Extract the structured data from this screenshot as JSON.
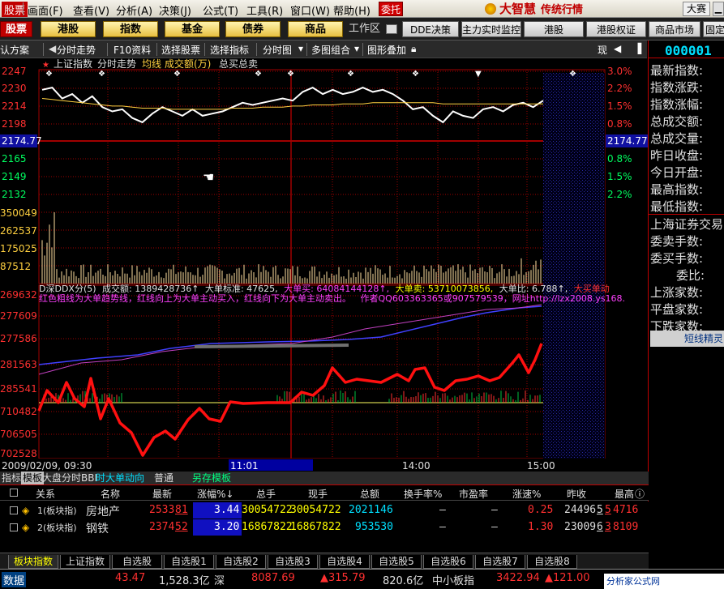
{
  "menu": {
    "items": [
      "股票",
      "画面(F)",
      "查看(V)",
      "分析(A)",
      "决策(J)",
      "公式(T)",
      "工具(R)",
      "窗口(W)",
      "帮助(H)"
    ],
    "entrust": "委托",
    "brand": "大智慧",
    "brand_sub": "传统行情",
    "contest": "大赛",
    "min": "▁"
  },
  "tabs": {
    "stocks": "股票",
    "hk": "港股",
    "index": "指数",
    "fund": "基金",
    "bond": "债券",
    "commodity": "商品",
    "workarea": "工作区",
    "dde": "DDE决策",
    "mainforce": "主力实时监控",
    "hk2": "港股",
    "hk_warrant": "港股权证",
    "commodity_market": "商品市场",
    "fixed": "固定"
  },
  "toolbar": {
    "scheme": "默认方案",
    "intraday": "分时走势",
    "f10": "F10资料",
    "select_stock": "选择股票",
    "select_index": "选择指标",
    "timeshare": "分时图",
    "multi": "多图组合",
    "overlay": "图形叠加",
    "current": "现"
  },
  "chart": {
    "header": {
      "name": "上证指数",
      "mode": "分时走势",
      "avg": "均线",
      "volume": "成交额(万)",
      "ratio": "总买总卖"
    },
    "price_axis_left": [
      "2247",
      "2230",
      "2214",
      "2198",
      "2174.77",
      "2165",
      "2149",
      "2132"
    ],
    "price_axis_right": [
      "3.0%",
      "2.2%",
      "1.5%",
      "0.8%",
      "2174.77",
      "0.8%",
      "1.5%",
      "2.2%"
    ],
    "volume_axis": [
      "350049",
      "262537",
      "175025",
      "87512"
    ],
    "ddx": {
      "title": "D深DDX分(5)",
      "turnover_label": "成交额:",
      "turnover": "1389428736↑",
      "bigorder_label": "大单标准:",
      "bigorder": "47625,",
      "buy_label": "大单买:",
      "buy": "64084144128↑,",
      "sell_label": "大单卖:",
      "sell": "53710073856,",
      "ratio_label": "大单比:",
      "ratio": "6.788↑,",
      "bigbuy": "大买单动",
      "desc": "红色粗线为大单趋势线，红线向上为大单主动买入，红线向下为大单主动卖出。",
      "author": "作者QQ603363365或907579539，网址http://lzx2008.ys168."
    },
    "ddx_axis": [
      "269632",
      "277609",
      "277586",
      "281563",
      "285541",
      "710482",
      "706505",
      "702528"
    ],
    "date": "2009/02/09, 09:30",
    "time_marks": [
      "11:01",
      "14:00",
      "15:00"
    ]
  },
  "chart_data": {
    "type": "line",
    "title": "上证指数 分时走势",
    "prev_close": 2174.77,
    "ylim": [
      2132,
      2247
    ],
    "x_range": [
      "09:30",
      "15:00"
    ],
    "series": [
      {
        "name": "上证指数",
        "values": [
          2230,
          2232,
          2222,
          2226,
          2218,
          2224,
          2214,
          2210,
          2212,
          2204,
          2200,
          2208,
          2214,
          2210,
          2206,
          2212,
          2206,
          2208,
          2210,
          2214,
          2218,
          2216,
          2218,
          2220,
          2222,
          2220,
          2228,
          2232,
          2226,
          2230,
          2226,
          2228,
          2232,
          2228,
          2230,
          2226,
          2220,
          2212,
          2214,
          2206,
          2200,
          2210,
          2206,
          2204,
          2212,
          2214,
          2210,
          2216,
          2218,
          2214,
          2220
        ]
      },
      {
        "name": "均线",
        "values": [
          2222,
          2221,
          2220,
          2219,
          2218,
          2217,
          2216,
          2215,
          2215,
          2214,
          2213,
          2213,
          2213,
          2212,
          2212,
          2212,
          2212,
          2212,
          2212,
          2213,
          2213,
          2213,
          2214,
          2214,
          2214,
          2215,
          2215,
          2216,
          2216,
          2216,
          2217,
          2217,
          2217,
          2218,
          2218,
          2218,
          2218,
          2218,
          2218,
          2218,
          2217,
          2217,
          2217,
          2217,
          2217,
          2217,
          2217,
          2217,
          2217,
          2217,
          2217
        ]
      }
    ]
  },
  "grid": {
    "tabs": {
      "indicator": "指标",
      "template": "模板",
      "dapan": "大盘分时BBI",
      "realtime": "时大单动向",
      "normal": "普通",
      "saveas": "另存模板"
    },
    "headers": [
      "关系",
      "名称",
      "最新",
      "涨幅%↓",
      "总手",
      "现手",
      "总额",
      "换手率%",
      "市盈率",
      "涨速%",
      "昨收",
      "最高"
    ],
    "rows": [
      {
        "rel": "1(板块指)",
        "name": "房地产",
        "last_a": "2533",
        "last_b": "81",
        "pct": "3.44",
        "vol_total": "30054722",
        "vol_now": "30054722",
        "amount": "2021146",
        "turnover": "–",
        "pe": "–",
        "speed": "0.25",
        "prev": "24496",
        "prev_b": "5",
        "high": "5",
        "high_b": "4716"
      },
      {
        "rel": "2(板块指)",
        "name": "钢铁",
        "last_a": "2374",
        "last_b": "52",
        "pct": "3.20",
        "vol_total": "16867822",
        "vol_now": "16867822",
        "amount": "953530",
        "turnover": "–",
        "pe": "–",
        "speed": "1.30",
        "prev": "23009",
        "prev_b": "6",
        "high": "3",
        "high_b": "8109"
      }
    ]
  },
  "sheets": [
    "板块指数",
    "上证指数",
    "自选股",
    "自选股1",
    "自选股2",
    "自选股3",
    "自选股4",
    "自选股5",
    "自选股6",
    "自选股7",
    "自选股8"
  ],
  "right_panel": {
    "code": "000001",
    "items": [
      "最新指数:",
      "指数涨跌:",
      "指数涨幅:",
      "总成交额:",
      "总成交量:",
      "昨日收盘:",
      "今日开盘:",
      "最高指数:",
      "最低指数:",
      "上海证券交易",
      "委卖手数:",
      "委买手数:",
      "委比:",
      "上涨家数:",
      "平盘家数:",
      "下跌家数:"
    ],
    "short_label": "短线精灵"
  },
  "status": {
    "left": "数据",
    "v1": "43.47",
    "v2": "1,528.3亿",
    "mkt": "深",
    "v3": "8087.69",
    "v4": "▲315.79",
    "v5": "820.6亿",
    "sme": "中小板指",
    "v6": "3422.94",
    "v7": "▲121.00",
    "watermark": "分析家公式网www.88gg.com"
  },
  "colors": {
    "index_line": "#ffffff",
    "avg_line": "#ffd040",
    "grid": "#a00000",
    "ddx_line": "#ff1010",
    "volume": "#ffe0a0",
    "up": "#ff3030"
  }
}
